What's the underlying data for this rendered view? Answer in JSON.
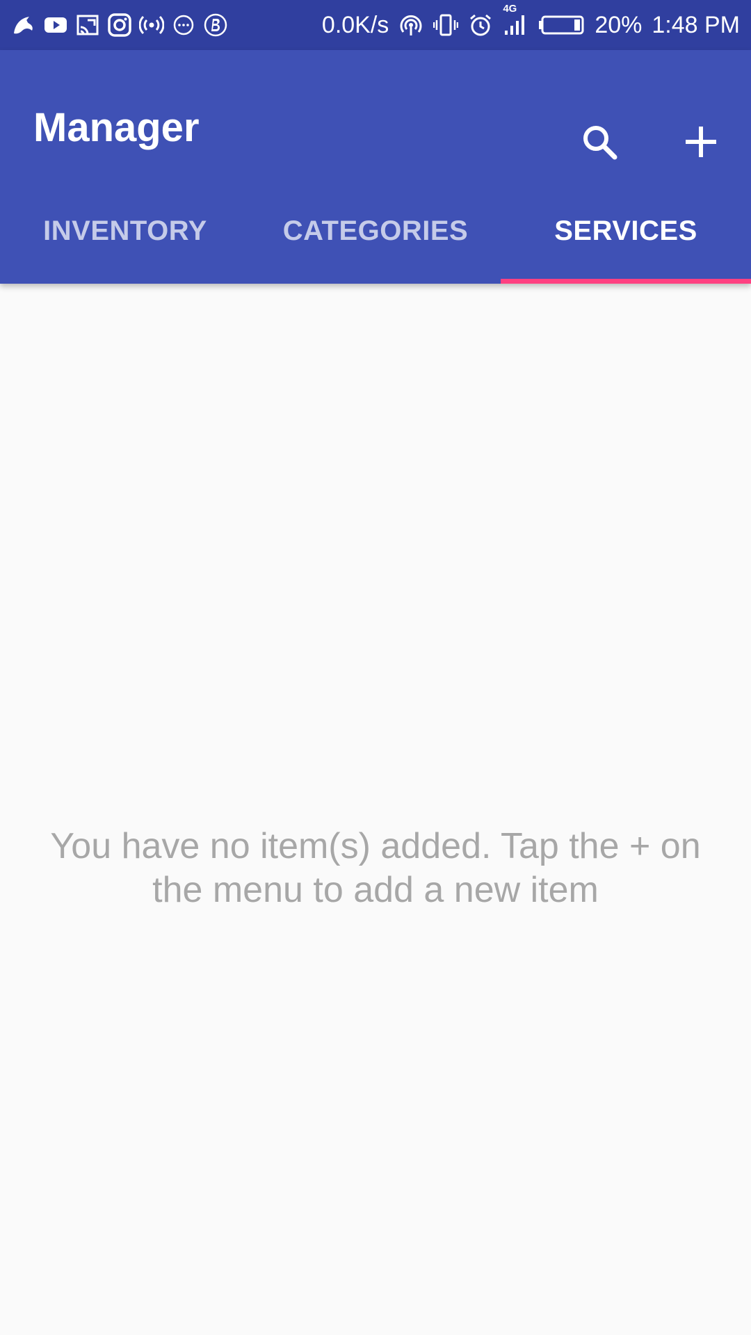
{
  "status_bar": {
    "net_speed": "0.0K/s",
    "network_type": "4G",
    "battery_percent": "20%",
    "time": "1:48 PM",
    "left_icons": [
      "bird-app-icon",
      "youtube-icon",
      "cast-icon",
      "instagram-icon",
      "hotspot-icon",
      "chat-icon",
      "b-app-icon"
    ],
    "right_icons": [
      "wireless-icon",
      "vibrate-icon",
      "alarm-icon",
      "signal-icon",
      "battery-icon"
    ]
  },
  "app_bar": {
    "title": "Manager",
    "actions": [
      "search-icon",
      "add-icon"
    ],
    "color": "#3f51b5",
    "status_color": "#303f9f"
  },
  "tabs": {
    "items": [
      {
        "label": "INVENTORY",
        "selected": false
      },
      {
        "label": "CATEGORIES",
        "selected": false
      },
      {
        "label": "SERVICES",
        "selected": true
      }
    ],
    "indicator_color": "#ff4081"
  },
  "content": {
    "empty_message": "You have no item(s) added. Tap the + on the menu to add a new item"
  }
}
